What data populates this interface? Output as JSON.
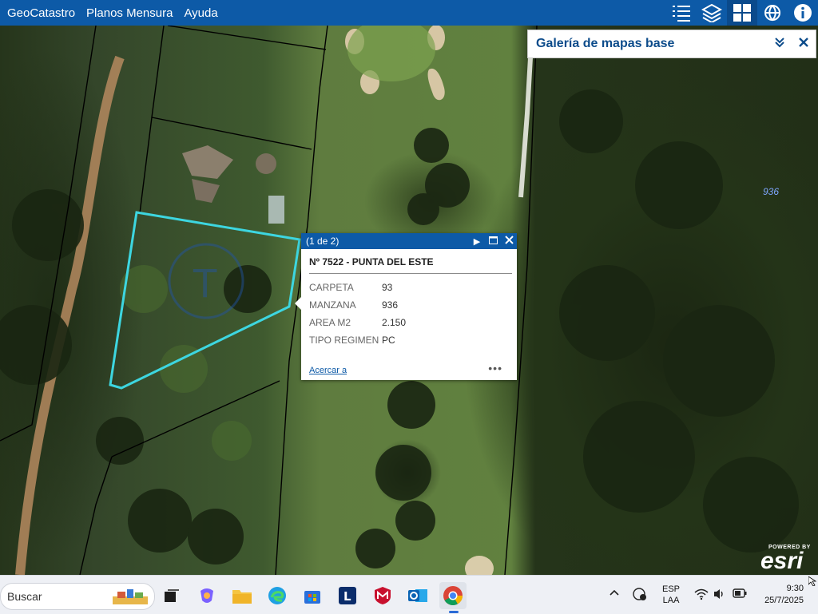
{
  "header": {
    "menu": [
      "GeoCatastro",
      "Planos Mensura",
      "Ayuda"
    ],
    "tools": [
      "list-icon",
      "layers-icon",
      "basemap-gallery-icon",
      "globe-share-icon",
      "info-icon"
    ]
  },
  "gallery_panel": {
    "title": "Galería de mapas base",
    "collapse_icon": "double-chevron-down-icon",
    "close_icon": "close-icon"
  },
  "map": {
    "parcel_label": "936",
    "outline_color": "#3dd6e0"
  },
  "popup": {
    "count": "(1 de 2)",
    "title": "Nº 7522 - PUNTA DEL ESTE",
    "fields": [
      {
        "key": "CARPETA",
        "value": "93"
      },
      {
        "key": "MANZANA",
        "value": "936"
      },
      {
        "key": "AREA M2",
        "value": "2.150"
      },
      {
        "key": "TIPO REGIMEN",
        "value": "PC"
      }
    ],
    "zoom_link": "Acercar a",
    "more": "•••"
  },
  "attribution": {
    "powered": "POWERED BY",
    "logo": "esri"
  },
  "taskbar": {
    "search_placeholder": "Buscar",
    "lang_top": "ESP",
    "lang_bottom": "LAA",
    "time": "9:30",
    "date": "25/7/2025"
  },
  "colors": {
    "topbar": "#0d5aa7",
    "link": "#0d5aa7"
  }
}
